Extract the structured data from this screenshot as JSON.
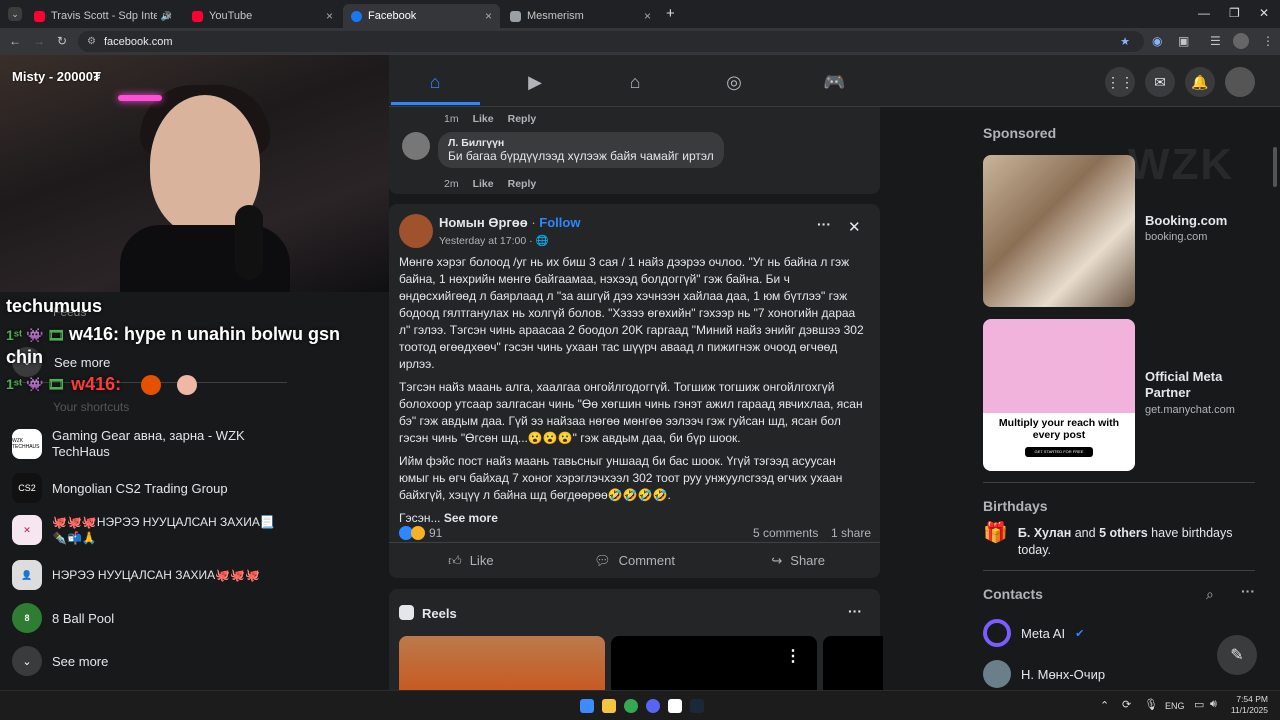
{
  "tabs": [
    {
      "title": "Travis Scott - Sdp Interlude",
      "color": "#ff0033",
      "close": "×"
    },
    {
      "title": "YouTube",
      "color": "#ff0033",
      "close": "×"
    },
    {
      "title": "Facebook",
      "color": "#1877f2",
      "close": "×"
    },
    {
      "title": "Mesmerism",
      "color": "#9aa0a6",
      "close": "×"
    }
  ],
  "browser": {
    "url": "facebook.com",
    "new_tab": "+"
  },
  "stream": {
    "overlay": "Misty - 20000₮",
    "chat1_user": "techumuus",
    "chat2": "w416:  hype n unahin bolwu gsn chin",
    "chat3": "w416:",
    "chat_ghost": "Feeds"
  },
  "left_nav": {
    "see_more_top": "See more",
    "shortcuts_label": "Your shortcuts",
    "items": [
      {
        "label": "Gaming Gear авна, зарна - WZK TechHaus",
        "icon": "WZK TECHHAUS"
      },
      {
        "label": "Mongolian CS2 Trading Group",
        "icon": "CS2"
      },
      {
        "label": "🐙🐙🐙НЭРЭЭ НУУЦАЛСАН ЗАХИА📃✒️📬🙏",
        "icon": "✕"
      },
      {
        "label": "НЭРЭЭ НУУЦАЛСАН ЗАХИА🐙🐙🐙",
        "icon": "👤"
      },
      {
        "label": "8 Ball Pool",
        "icon": "8"
      }
    ],
    "see_more": "See more"
  },
  "comments": [
    {
      "meta_time": "1m",
      "like": "Like",
      "reply": "Reply"
    },
    {
      "author": "Л. Билгүүн",
      "text": "Би багаа бүрдүүлээд хүлээж байя чамайг иртэл",
      "meta_time": "2m",
      "like": "Like",
      "reply": "Reply"
    }
  ],
  "post": {
    "author": "Номын Өргөө",
    "follow": "Follow",
    "time": "Yesterday at 17:00 · 🌐",
    "more": "···",
    "close": "✕",
    "p1": "Мөнгө хэрэг болоод  /уг нь их биш 3 сая / 1 найз дээрээ очлоо. \"Уг нь байна л гэж байна, 1 нөхрийн мөнгө байгаамаа, нэхээд болдоггүй\" гэж байна. Би ч өндөсхийгөөд л баярлаад л \"за ашгүй дээ хэчнээн хайлаа даа, 1 юм бүтлээ\" гэж бодоод гялтганулах нь холгүй болов. \"Хэзээ өгөхийн\" гэхээр нь \"7 хоногийн дараа л\" гэлээ. Тэгсэн чинь араасаа 2 боодол 20K гаргаад \"Миний найз энийг дэвшээ 302 тоотод өгөөдхөөч\" гэсэн чинь ухаан тас шүүрч аваад л пижигнэж очоод өгчөөд ирлээ.",
    "p2": "Тэгсэн найз маань алга, хаалгаа онгойлгодоггүй. Тогшиж тогшиж онгойлгохгүй болохоор утсаар залгасан чинь \"Өө хөгшин чинь гэнэт ажил гараад явчихлаа, ясан бэ\" гэж авдым даа. Гүй ээ найзаа нөгөө мөнгөө ээлээч гэж гуйсан шд, ясан бол гэсэн чинь \"Өгсөн шд...😮😮😮\" гэж авдым даа, би бүр шоок.",
    "p3": "Ийм фэйс пост найз маань тавьсныг  уншаад би бас шоок. Үгүй тэгээд асуусан юмыг нь өгч байхад 7 хоног хэрэглэчхээл 302 тоот руу унжуулсгээд өгчих ухаан байхгүй, хэцүү л байна шд бөгдөөрөө🤣🤣🤣🤣.",
    "p4": "Гэсэн...",
    "see_more": "See more",
    "reactions": "91",
    "comments": "5 comments",
    "shares": "1 share",
    "like": "Like",
    "comment": "Comment",
    "share": "Share"
  },
  "reels": {
    "title": "Reels",
    "more": "···"
  },
  "right": {
    "sponsored": "Sponsored",
    "ads": [
      {
        "title": "Booking.com",
        "domain": "booking.com"
      },
      {
        "title": "Official Meta Partner",
        "domain": "get.manychat.com",
        "img_text": "Multiply your reach with every post",
        "img_btn": "GET STARTED FOR FREE"
      }
    ],
    "birthdays_label": "Birthdays",
    "birthday_name": "Б. Хулан",
    "birthday_mid": " and ",
    "birthday_others": "5 others",
    "birthday_tail": " have birthdays today.",
    "contacts_label": "Contacts",
    "contacts": [
      {
        "name": "Meta AI"
      },
      {
        "name": "Н. Мөнх-Очир"
      }
    ],
    "watermark": "WZK"
  },
  "taskbar": {
    "lang": "ENG",
    "time": "7:54 PM",
    "date": "11/1/2025"
  },
  "colors": {
    "fb_blue": "#2d88ff",
    "bg": "#18191a",
    "card": "#242526"
  }
}
